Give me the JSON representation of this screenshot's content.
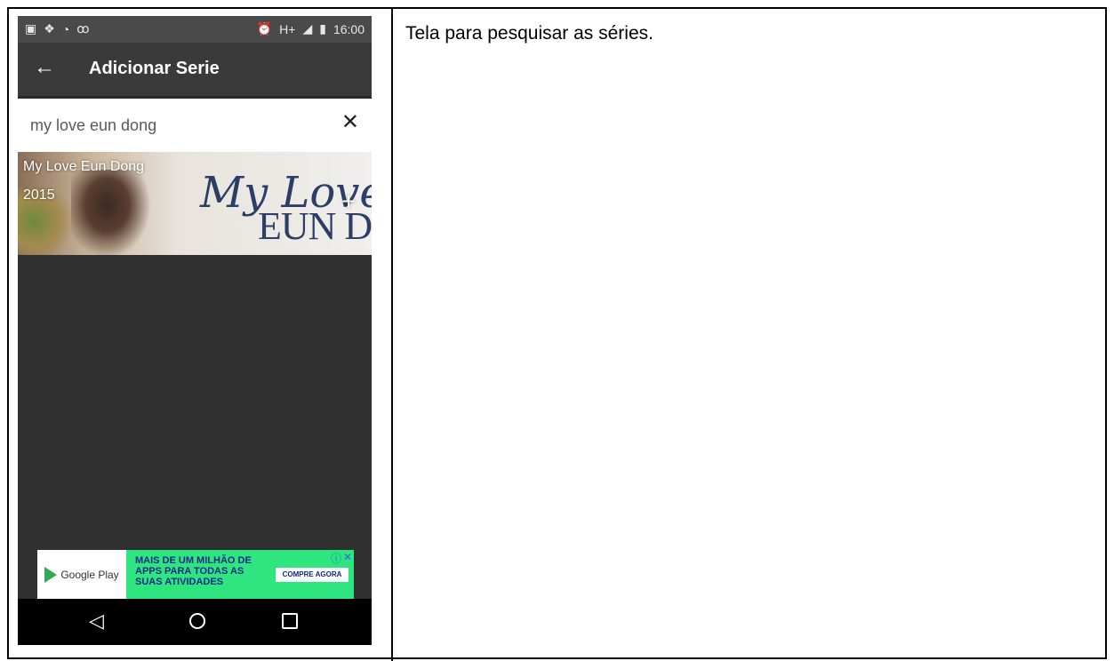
{
  "description": "Tela para pesquisar as séries.",
  "status_bar": {
    "time": "16:00",
    "network": "H+",
    "left_icons": [
      "gallery-icon",
      "dropbox-icon",
      "wifi-icon",
      "voicemail-icon"
    ],
    "right_icons": [
      "alarm-icon",
      "signal-icon",
      "battery-icon"
    ]
  },
  "app_bar": {
    "title": "Adicionar Serie",
    "back_icon": "arrow-left-icon"
  },
  "search": {
    "value": "my love eun dong",
    "clear_icon": "close-icon"
  },
  "results": [
    {
      "title": "My Love Eun Dong",
      "year": "2015",
      "logo_line1": "My Love",
      "logo_line2": "EUN D",
      "action_icon": "plus-icon"
    }
  ],
  "ad": {
    "brand": "Google Play",
    "text": "MAIS DE UM MILHÃO DE APPS PARA TODAS AS SUAS ATIVIDADES",
    "cta": "COMPRE AGORA",
    "bg_color": "#2ee57f"
  },
  "nav_bar": {
    "back_icon": "triangle-back-icon",
    "home_icon": "circle-home-icon",
    "recents_icon": "square-recents-icon"
  }
}
